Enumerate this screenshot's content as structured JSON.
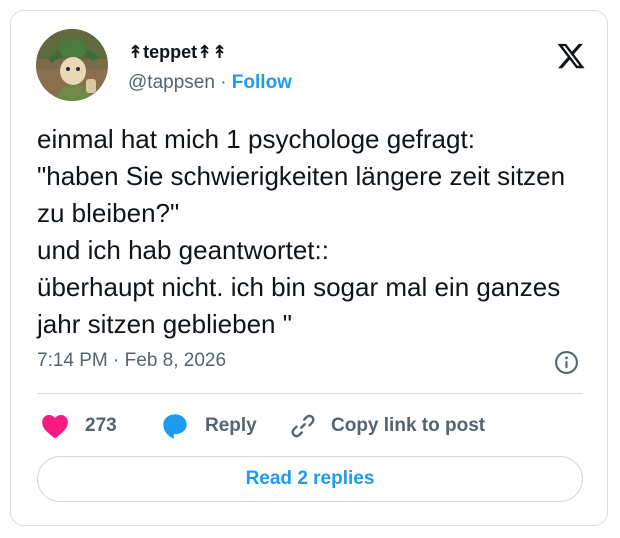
{
  "author": {
    "display_name": "↟teppet↟↟",
    "handle": "@tappsen",
    "separator": "·",
    "follow_label": "Follow"
  },
  "post": {
    "text": "einmal hat mich 1 psychologe gefragt:\n\"haben Sie schwierigkeiten längere zeit sitzen zu bleiben?\"\nund ich hab geantwortet::\nüberhaupt nicht. ich bin sogar mal ein ganzes jahr sitzen geblieben \"",
    "time": "7:14 PM",
    "separator": "·",
    "date": "Feb 8, 2026"
  },
  "actions": {
    "like_count": "273",
    "reply_label": "Reply",
    "copy_label": "Copy link to post"
  },
  "read_replies_label": "Read 2 replies",
  "colors": {
    "like": "#f91880",
    "reply_bubble": "#1d9bf0",
    "link": "#1d9bf0",
    "secondary_text": "#536471",
    "border": "#d9dde1"
  },
  "icons": [
    "avatar-image",
    "x-logo-icon",
    "info-icon",
    "heart-icon",
    "reply-bubble-icon",
    "link-icon"
  ]
}
